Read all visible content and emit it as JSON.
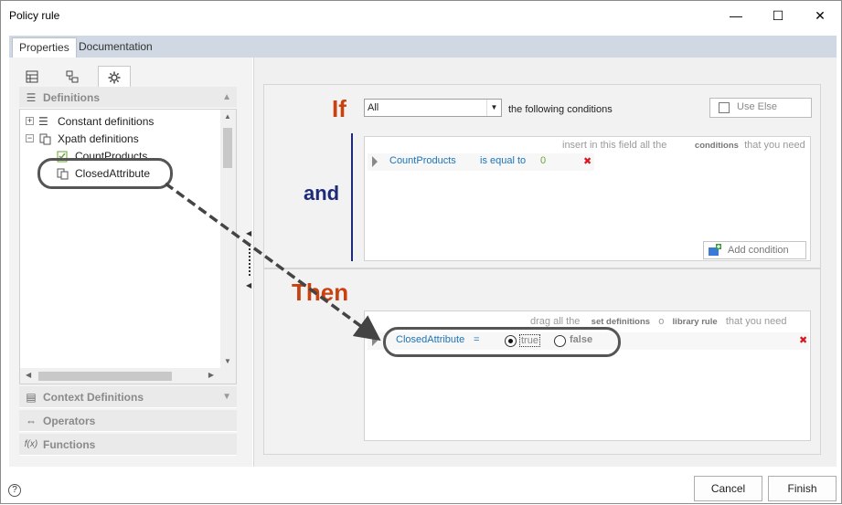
{
  "window": {
    "title": "Policy rule",
    "minimize": "—",
    "maximize": "☐",
    "close": "✕"
  },
  "tabs": [
    {
      "label": "Properties"
    },
    {
      "label": "Documentation"
    }
  ],
  "left": {
    "icon_tabs": [
      "grid-icon",
      "tree-icon",
      "gear-icon"
    ],
    "definitions_header": "Definitions",
    "tree": {
      "constant": "Constant definitions",
      "xpath": "Xpath definitions",
      "count_products": "CountProducts",
      "closed_attribute": "ClosedAttribute"
    },
    "context_header": "Context Definitions",
    "operators_header": "Operators",
    "functions_header": "Functions",
    "functions_icon_text": "f(x)"
  },
  "rule": {
    "if_word": "If",
    "and_word": "and",
    "then_word": "Then",
    "match_select": "All",
    "following_text": "the following conditions",
    "use_else": "Use Else",
    "cond_hint_1": "insert in this field all the",
    "cond_hint_2": "conditions",
    "cond_hint_3": "that you need",
    "condition": {
      "left": "CountProducts",
      "op": "is equal to",
      "right": "0"
    },
    "add_condition": "Add condition",
    "then_hint_1": "drag all the",
    "then_hint_2": "set definitions",
    "then_hint_3": "o",
    "then_hint_4": "library rule",
    "then_hint_5": "that you need",
    "action": {
      "target": "ClosedAttribute",
      "op": "=",
      "true_label": "true",
      "false_label": "false"
    }
  },
  "footer": {
    "help": "?",
    "cancel": "Cancel",
    "finish": "Finish"
  },
  "colors": {
    "if_color": "#c8410f",
    "and_color": "#1e2a7a",
    "link_blue": "#1a74b8",
    "green_value": "#6aa339"
  }
}
